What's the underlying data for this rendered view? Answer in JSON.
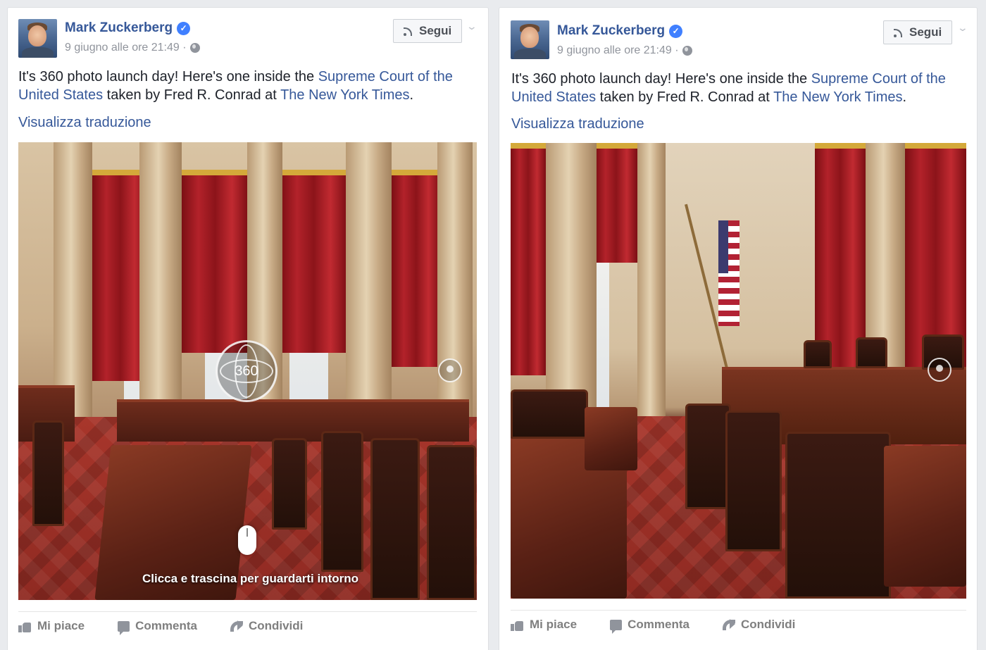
{
  "posts": [
    {
      "author": "Mark Zuckerberg",
      "date": "9 giugno alle ore 21:49 ·",
      "follow_label": "Segui",
      "text_before": "It's 360 photo launch day! Here's one inside the ",
      "link1": "Supreme Court of the United States",
      "text_mid": " taken by Fred R. Conrad at ",
      "link2": "The New York Times",
      "text_end": ".",
      "translate_label": "Visualizza traduzione",
      "badge_360": "360",
      "drag_hint": "Clicca e trascina per guardarti intorno",
      "actions": {
        "like": "Mi piace",
        "comment": "Commenta",
        "share": "Condividi"
      }
    },
    {
      "author": "Mark Zuckerberg",
      "date": "9 giugno alle ore 21:49 ·",
      "follow_label": "Segui",
      "text_before": "It's 360 photo launch day! Here's one inside the ",
      "link1": "Supreme Court of the United States",
      "text_mid": " taken by Fred R. Conrad at ",
      "link2": "The New York Times",
      "text_end": ".",
      "translate_label": "Visualizza traduzione",
      "actions": {
        "like": "Mi piace",
        "comment": "Commenta",
        "share": "Condividi"
      }
    }
  ],
  "colors": {
    "link": "#365899",
    "background": "#e9ebee",
    "verified": "#4080ff",
    "muted": "#90949c"
  },
  "icons": [
    "verified-badge-icon",
    "globe-icon",
    "rss-icon",
    "chevron-down-icon",
    "360-icon",
    "compass-icon",
    "mouse-icon",
    "like-icon",
    "comment-icon",
    "share-icon"
  ]
}
